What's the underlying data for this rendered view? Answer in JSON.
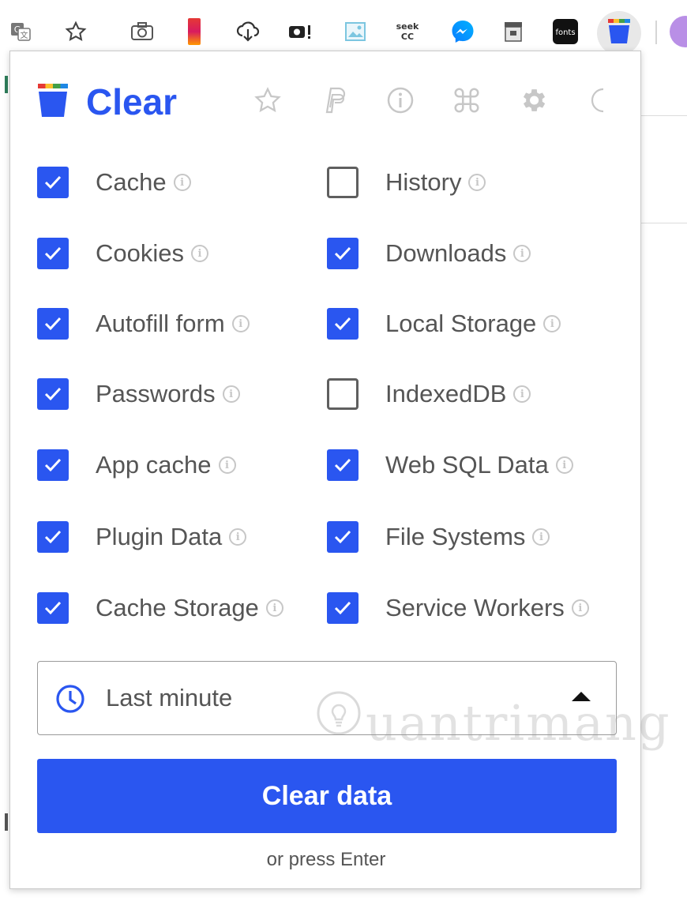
{
  "toolbar": {
    "icons": [
      "translate-icon",
      "star-icon",
      "camera-icon",
      "phone-color-icon",
      "cloud-download-icon",
      "camera-record-icon",
      "image-icon",
      "seekcc-icon",
      "messenger-icon",
      "archive-icon",
      "fonts-icon",
      "clear-bucket-icon"
    ],
    "seek_label_1": "seek",
    "seek_label_2": "CC",
    "fonts_label": "fonts"
  },
  "popup": {
    "title": "Clear",
    "header_icons": [
      "star-icon",
      "paypal-icon",
      "info-icon",
      "command-icon",
      "gear-icon",
      "moon-icon"
    ],
    "options_left": [
      {
        "label": "Cache",
        "checked": true
      },
      {
        "label": "Cookies",
        "checked": true
      },
      {
        "label": "Autofill form",
        "checked": true
      },
      {
        "label": "Passwords",
        "checked": true
      },
      {
        "label": "App cache",
        "checked": true
      },
      {
        "label": "Plugin Data",
        "checked": true
      },
      {
        "label": "Cache Storage",
        "checked": true
      }
    ],
    "options_right": [
      {
        "label": "History",
        "checked": false
      },
      {
        "label": "Downloads",
        "checked": true
      },
      {
        "label": "Local Storage",
        "checked": true
      },
      {
        "label": "IndexedDB",
        "checked": false
      },
      {
        "label": "Web SQL Data",
        "checked": true
      },
      {
        "label": "File Systems",
        "checked": true
      },
      {
        "label": "Service Workers",
        "checked": true
      }
    ],
    "time_range": {
      "value": "Last minute"
    },
    "clear_button": "Clear data",
    "hint": "or press Enter"
  },
  "watermark": "uantrimang",
  "colors": {
    "accent": "#2a56f0",
    "text": "#555555",
    "muted": "#c7c7c7"
  }
}
